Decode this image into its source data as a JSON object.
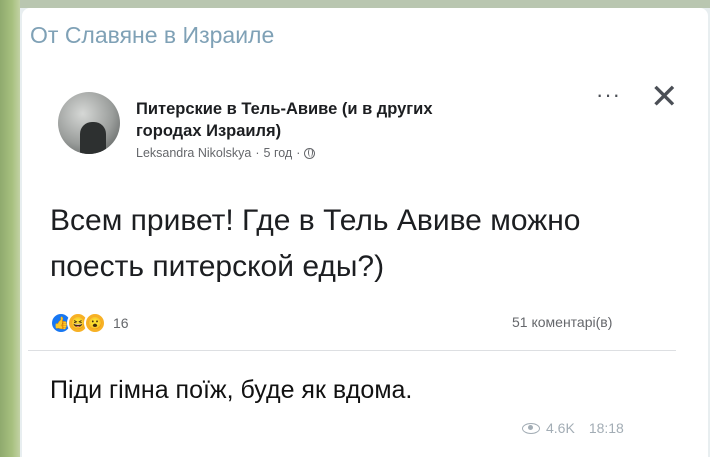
{
  "message": {
    "sender": "От Славяне в Израиле",
    "reply_text": "Піди гімна поїж, буде як вдома.",
    "views": "4.6K",
    "time": "18:18"
  },
  "post": {
    "group_name": "Питерские в Тель-Авиве (и в других городах Израиля)",
    "author": "Leksandra Nikolskya",
    "separator": "·",
    "age": "5 год",
    "text": "Всем привет! Где в Тель Авиве можно поесть питерской еды?)",
    "more_label": "···",
    "close_label": "✕",
    "reactions": {
      "icons": [
        "like-icon",
        "haha-icon",
        "wow-icon"
      ],
      "glyphs": [
        "👍",
        "😆",
        "😮"
      ],
      "count": "16"
    },
    "comments": "51 коментарі(в)"
  },
  "colors": {
    "sender": "#7fa1b6",
    "accent_strip": "#a7c07f",
    "meta_gray": "#65676b",
    "footer_gray": "#a3adb5"
  }
}
